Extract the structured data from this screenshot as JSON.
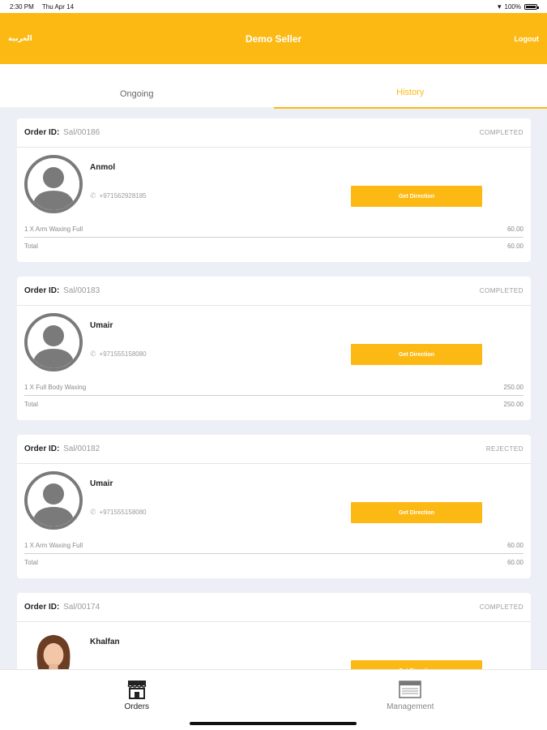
{
  "status_bar": {
    "time": "2:30 PM",
    "date": "Thu Apr 14",
    "battery": "100%",
    "battery_level": 1.0
  },
  "header": {
    "language_label": "العربية",
    "title": "Demo Seller",
    "logout_label": "Logout",
    "accent_color": "#fdb913"
  },
  "tabs": [
    {
      "label": "Ongoing",
      "active": false
    },
    {
      "label": "History",
      "active": true
    }
  ],
  "orders": [
    {
      "order_label": "Order ID:",
      "order_id": "Sal/00186",
      "status": "COMPLETED",
      "customer": "Anmol",
      "phone": "+971562928185",
      "button_label": "Get Direction",
      "item": "1 X Arm Waxing Full",
      "item_price": "60.00",
      "total_label": "Total",
      "total": "60.00",
      "avatar": "placeholder-avatar-icon"
    },
    {
      "order_label": "Order ID:",
      "order_id": "Sal/00183",
      "status": "COMPLETED",
      "customer": "Umair",
      "phone": "+971555158080",
      "button_label": "Get Direction",
      "item": "1 X Full Body Waxing",
      "item_price": "250.00",
      "total_label": "Total",
      "total": "250.00",
      "avatar": "placeholder-avatar-icon"
    },
    {
      "order_label": "Order ID:",
      "order_id": "Sal/00182",
      "status": "REJECTED",
      "customer": "Umair",
      "phone": "+971555158080",
      "button_label": "Get Direction",
      "item": "1 X Arm Waxing Full",
      "item_price": "60.00",
      "total_label": "Total",
      "total": "60.00",
      "avatar": "placeholder-avatar-icon"
    },
    {
      "order_label": "Order ID:",
      "order_id": "Sal/00174",
      "status": "COMPLETED",
      "customer": "Khalfan",
      "phone": "",
      "button_label": "Get Direction",
      "item": "",
      "item_price": "",
      "total_label": "",
      "total": "",
      "avatar": "woman-photo"
    }
  ],
  "bottom_nav": [
    {
      "label": "Orders",
      "icon": "store-icon",
      "active": true
    },
    {
      "label": "Management",
      "icon": "calendar-icon",
      "active": false
    }
  ]
}
